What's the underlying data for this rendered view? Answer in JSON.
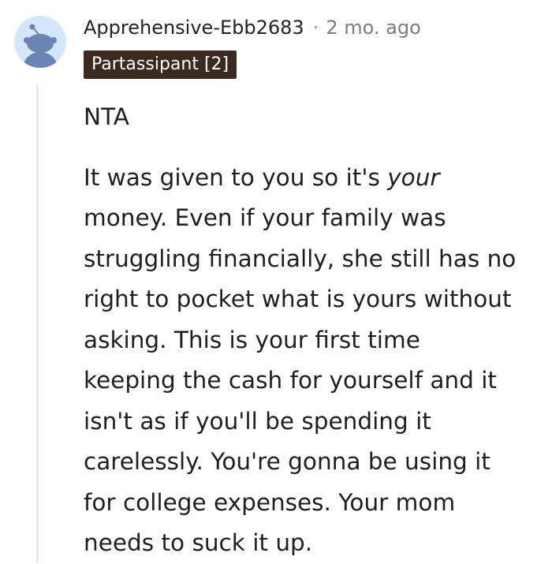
{
  "comment": {
    "username": "Apprehensive-Ebb2683",
    "separator": "·",
    "timestamp": "2 mo. ago",
    "flair": "Partassipant [2]",
    "paragraph1": "NTA",
    "paragraph2": {
      "line1_pre": "It was given to you so it's ",
      "line1_em": "your",
      "line2": "money. Even if your family was",
      "line3": "struggling financially, she still has no",
      "line4": "right to pocket what is yours without",
      "line5": "asking. This is your first time",
      "line6": "keeping the cash for yourself and it",
      "line7": "isn't as if you'll be spending it",
      "line8": "carelessly. You're gonna be using it",
      "line9": "for college expenses. Your mom",
      "line10": "needs to suck it up."
    }
  },
  "colors": {
    "avatar_bg": "#d4e6fb",
    "avatar_figure": "#6d83b3",
    "flair_bg": "#3b2a20",
    "flair_text": "#ffffff",
    "thread_line": "#e6e8ea"
  },
  "icons": {
    "avatar": "snoo-avatar-icon"
  }
}
